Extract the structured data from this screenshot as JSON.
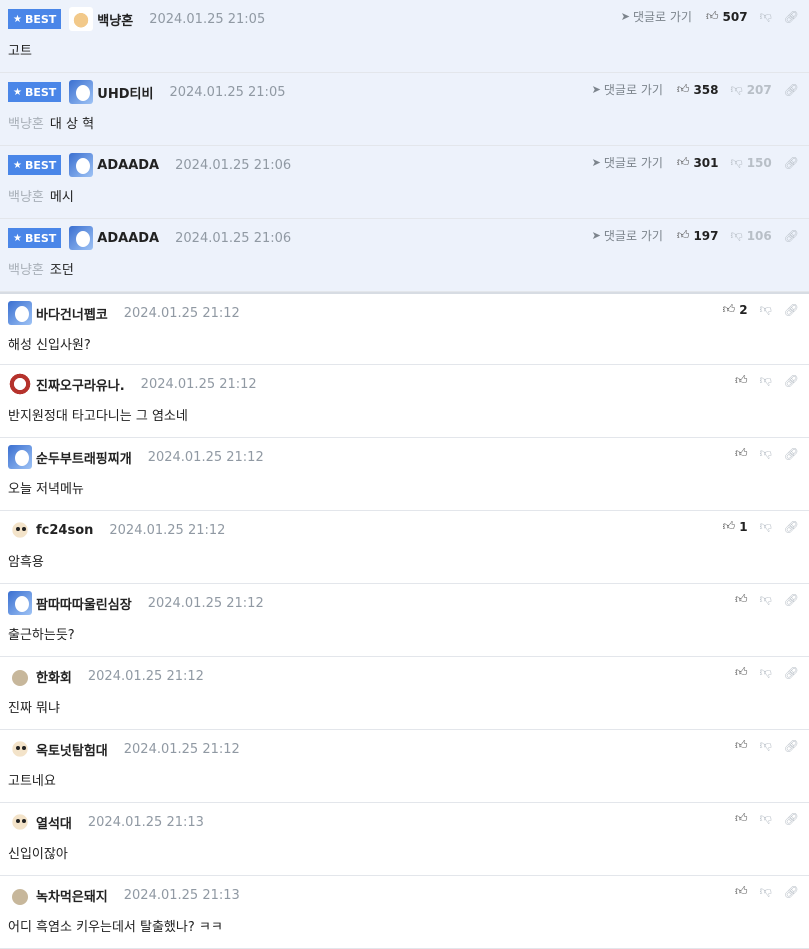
{
  "goto_label": "댓글로 가기",
  "best_label": "BEST",
  "comments": [
    {
      "type": "best",
      "avatar": "av-dog1",
      "nick": "백냥혼",
      "date": "2024.01.25 21:05",
      "mention": "",
      "text": "고트",
      "up": "507",
      "down": "",
      "goto": true
    },
    {
      "type": "best",
      "avatar": "av-white",
      "nick": "UHD티비",
      "date": "2024.01.25 21:05",
      "mention": "백냥혼",
      "text": "대 상 혁",
      "up": "358",
      "down": "207",
      "goto": true
    },
    {
      "type": "best",
      "avatar": "av-white",
      "nick": "ADAADA",
      "date": "2024.01.25 21:06",
      "mention": "백냥혼",
      "text": "메시",
      "up": "301",
      "down": "150",
      "goto": true
    },
    {
      "type": "best",
      "avatar": "av-white",
      "nick": "ADAADA",
      "date": "2024.01.25 21:06",
      "mention": "백냥혼",
      "text": "조던",
      "up": "197",
      "down": "106",
      "goto": true
    },
    {
      "type": "normal",
      "avatar": "av-white",
      "nick": "바다건너펩코",
      "date": "2024.01.25 21:12",
      "mention": "",
      "text": "해성 신입사원?",
      "up": "2",
      "down": ""
    },
    {
      "type": "normal",
      "avatar": "av-red",
      "nick": "진짜오구라유나.",
      "date": "2024.01.25 21:12",
      "mention": "",
      "text": "반지원정대 타고다니는 그 염소네",
      "up": "",
      "down": ""
    },
    {
      "type": "normal",
      "avatar": "av-white",
      "nick": "순두부트래핑찌개",
      "date": "2024.01.25 21:12",
      "mention": "",
      "text": "오늘 저녁메뉴",
      "up": "",
      "down": ""
    },
    {
      "type": "normal",
      "avatar": "av-puppy",
      "nick": "fc24son",
      "date": "2024.01.25 21:12",
      "mention": "",
      "text": "암흑용",
      "up": "1",
      "down": ""
    },
    {
      "type": "normal",
      "avatar": "av-white",
      "nick": "팜따따따울린심장",
      "date": "2024.01.25 21:12",
      "mention": "",
      "text": "출근하는듯?",
      "up": "",
      "down": ""
    },
    {
      "type": "normal",
      "avatar": "av-dot",
      "nick": "한화회",
      "date": "2024.01.25 21:12",
      "mention": "",
      "text": "진짜 뭐냐",
      "up": "",
      "down": ""
    },
    {
      "type": "normal",
      "avatar": "av-puppy",
      "nick": "옥토넛탐험대",
      "date": "2024.01.25 21:12",
      "mention": "",
      "text": "고트네요",
      "up": "",
      "down": ""
    },
    {
      "type": "normal",
      "avatar": "av-puppy",
      "nick": "열석대",
      "date": "2024.01.25 21:13",
      "mention": "",
      "text": "신입이잖아",
      "up": "",
      "down": ""
    },
    {
      "type": "normal",
      "avatar": "av-dot",
      "nick": "녹차먹은돼지",
      "date": "2024.01.25 21:13",
      "mention": "",
      "text": "어디 흑염소 키우는데서 탈출했나? ㅋㅋ",
      "up": "",
      "down": ""
    }
  ]
}
